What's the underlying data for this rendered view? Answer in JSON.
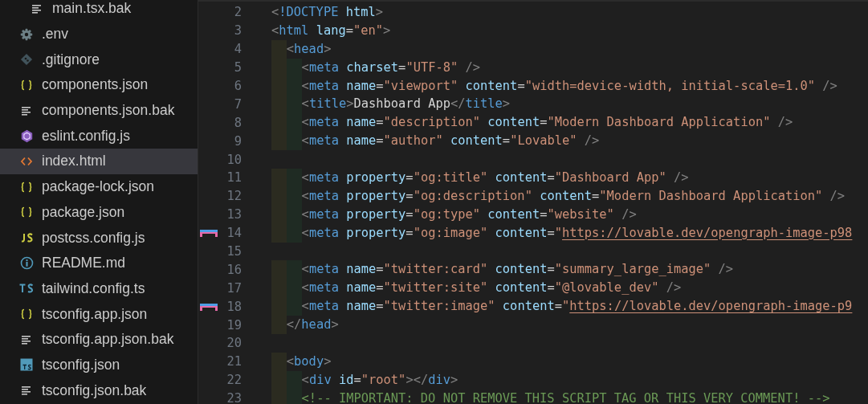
{
  "sidebar": {
    "items": [
      {
        "children": [
          {
            "name": "main.tsx.bak",
            "kind": "lines",
            "selected": false
          }
        ]
      },
      {
        "name": ".env",
        "kind": "gear",
        "selected": false
      },
      {
        "name": ".gitignore",
        "kind": "git",
        "selected": false
      },
      {
        "name": "components.json",
        "kind": "braces",
        "selected": false
      },
      {
        "name": "components.json.bak",
        "kind": "lines",
        "selected": false
      },
      {
        "name": "eslint.config.js",
        "kind": "eslint",
        "selected": false
      },
      {
        "name": "index.html",
        "kind": "html",
        "selected": true
      },
      {
        "name": "package-lock.json",
        "kind": "braces",
        "selected": false
      },
      {
        "name": "package.json",
        "kind": "braces",
        "selected": false
      },
      {
        "name": "postcss.config.js",
        "kind": "js",
        "selected": false
      },
      {
        "name": "README.md",
        "kind": "info",
        "selected": false
      },
      {
        "name": "tailwind.config.ts",
        "kind": "ts",
        "selected": false
      },
      {
        "name": "tsconfig.app.json",
        "kind": "braces",
        "selected": false
      },
      {
        "name": "tsconfig.app.json.bak",
        "kind": "lines",
        "selected": false
      },
      {
        "name": "tsconfig.json",
        "kind": "tsbox",
        "selected": false
      },
      {
        "name": "tsconfig.json.bak",
        "kind": "lines",
        "selected": false
      }
    ]
  },
  "editor": {
    "lines": [
      {
        "number": "2",
        "tokens": [
          {
            "kind": "punct",
            "text": "<"
          },
          {
            "kind": "tag",
            "text": "!DOCTYPE"
          },
          {
            "kind": "attr",
            "text": " html"
          },
          {
            "kind": "punct",
            "text": ">"
          }
        ]
      },
      {
        "number": "3",
        "tokens": [
          {
            "kind": "punct",
            "text": "<"
          },
          {
            "kind": "tag",
            "text": "html"
          },
          {
            "kind": "attr",
            "text": " lang"
          },
          {
            "kind": "text",
            "text": "="
          },
          {
            "kind": "string",
            "text": "\"en\""
          },
          {
            "kind": "punct",
            "text": ">"
          }
        ]
      },
      {
        "number": "4",
        "guides": [
          {
            "kind": "outer"
          }
        ],
        "tokens": [
          {
            "kind": "punct",
            "text": "<"
          },
          {
            "kind": "tag",
            "text": "head"
          },
          {
            "kind": "punct",
            "text": ">"
          }
        ]
      },
      {
        "number": "5",
        "guides": [
          {
            "kind": "outer"
          },
          {
            "kind": "inner"
          }
        ],
        "tokens": [
          {
            "kind": "punct",
            "text": "<"
          },
          {
            "kind": "tag",
            "text": "meta"
          },
          {
            "kind": "attr",
            "text": " charset"
          },
          {
            "kind": "text",
            "text": "="
          },
          {
            "kind": "string",
            "text": "\"UTF-8\""
          },
          {
            "kind": "punct",
            "text": " />"
          }
        ]
      },
      {
        "number": "6",
        "guides": [
          {
            "kind": "outer"
          },
          {
            "kind": "inner"
          }
        ],
        "tokens": [
          {
            "kind": "punct",
            "text": "<"
          },
          {
            "kind": "tag",
            "text": "meta"
          },
          {
            "kind": "attr",
            "text": " name"
          },
          {
            "kind": "text",
            "text": "="
          },
          {
            "kind": "string",
            "text": "\"viewport\""
          },
          {
            "kind": "attr",
            "text": " content"
          },
          {
            "kind": "text",
            "text": "="
          },
          {
            "kind": "string",
            "text": "\"width=device-width, initial-scale=1.0\""
          },
          {
            "kind": "punct",
            "text": " />"
          }
        ]
      },
      {
        "number": "7",
        "guides": [
          {
            "kind": "outer"
          },
          {
            "kind": "inner"
          }
        ],
        "tokens": [
          {
            "kind": "punct",
            "text": "<"
          },
          {
            "kind": "tag",
            "text": "title"
          },
          {
            "kind": "punct",
            "text": ">"
          },
          {
            "kind": "text",
            "text": "Dashboard App"
          },
          {
            "kind": "punct",
            "text": "</"
          },
          {
            "kind": "tag",
            "text": "title"
          },
          {
            "kind": "punct",
            "text": ">"
          }
        ]
      },
      {
        "number": "8",
        "guides": [
          {
            "kind": "outer"
          },
          {
            "kind": "inner"
          }
        ],
        "tokens": [
          {
            "kind": "punct",
            "text": "<"
          },
          {
            "kind": "tag",
            "text": "meta"
          },
          {
            "kind": "attr",
            "text": " name"
          },
          {
            "kind": "text",
            "text": "="
          },
          {
            "kind": "string",
            "text": "\"description\""
          },
          {
            "kind": "attr",
            "text": " content"
          },
          {
            "kind": "text",
            "text": "="
          },
          {
            "kind": "string",
            "text": "\"Modern Dashboard Application\""
          },
          {
            "kind": "punct",
            "text": " />"
          }
        ]
      },
      {
        "number": "9",
        "guides": [
          {
            "kind": "outer"
          },
          {
            "kind": "inner"
          }
        ],
        "tokens": [
          {
            "kind": "punct",
            "text": "<"
          },
          {
            "kind": "tag",
            "text": "meta"
          },
          {
            "kind": "attr",
            "text": " name"
          },
          {
            "kind": "text",
            "text": "="
          },
          {
            "kind": "string",
            "text": "\"author\""
          },
          {
            "kind": "attr",
            "text": " content"
          },
          {
            "kind": "text",
            "text": "="
          },
          {
            "kind": "string",
            "text": "\"Lovable\""
          },
          {
            "kind": "punct",
            "text": " />"
          }
        ]
      },
      {
        "number": "10"
      },
      {
        "number": "11",
        "guides": [
          {
            "kind": "outer"
          },
          {
            "kind": "inner"
          }
        ],
        "tokens": [
          {
            "kind": "punct",
            "text": "<"
          },
          {
            "kind": "tag",
            "text": "meta"
          },
          {
            "kind": "attr",
            "text": " property"
          },
          {
            "kind": "text",
            "text": "="
          },
          {
            "kind": "string",
            "text": "\"og:title\""
          },
          {
            "kind": "attr",
            "text": " content"
          },
          {
            "kind": "text",
            "text": "="
          },
          {
            "kind": "string",
            "text": "\"Dashboard App\""
          },
          {
            "kind": "punct",
            "text": " />"
          }
        ]
      },
      {
        "number": "12",
        "guides": [
          {
            "kind": "outer"
          },
          {
            "kind": "inner"
          }
        ],
        "tokens": [
          {
            "kind": "punct",
            "text": "<"
          },
          {
            "kind": "tag",
            "text": "meta"
          },
          {
            "kind": "attr",
            "text": " property"
          },
          {
            "kind": "text",
            "text": "="
          },
          {
            "kind": "string",
            "text": "\"og:description\""
          },
          {
            "kind": "attr",
            "text": " content"
          },
          {
            "kind": "text",
            "text": "="
          },
          {
            "kind": "string",
            "text": "\"Modern Dashboard Application\""
          },
          {
            "kind": "punct",
            "text": " />"
          }
        ]
      },
      {
        "number": "13",
        "guides": [
          {
            "kind": "outer"
          },
          {
            "kind": "inner"
          }
        ],
        "tokens": [
          {
            "kind": "punct",
            "text": "<"
          },
          {
            "kind": "tag",
            "text": "meta"
          },
          {
            "kind": "attr",
            "text": " property"
          },
          {
            "kind": "text",
            "text": "="
          },
          {
            "kind": "string",
            "text": "\"og:type\""
          },
          {
            "kind": "attr",
            "text": " content"
          },
          {
            "kind": "text",
            "text": "="
          },
          {
            "kind": "string",
            "text": "\"website\""
          },
          {
            "kind": "punct",
            "text": " />"
          }
        ]
      },
      {
        "number": "14",
        "marker": true,
        "guides": [
          {
            "kind": "outer"
          },
          {
            "kind": "inner"
          }
        ],
        "tokens": [
          {
            "kind": "punct",
            "text": "<"
          },
          {
            "kind": "tag",
            "text": "meta"
          },
          {
            "kind": "attr",
            "text": " property"
          },
          {
            "kind": "text",
            "text": "="
          },
          {
            "kind": "string",
            "text": "\"og:image\""
          },
          {
            "kind": "attr",
            "text": " content"
          },
          {
            "kind": "text",
            "text": "="
          },
          {
            "kind": "string",
            "text": "\""
          },
          {
            "kind": "link",
            "text": "https://lovable.dev/opengraph-image-p98"
          }
        ]
      },
      {
        "number": "15"
      },
      {
        "number": "16",
        "guides": [
          {
            "kind": "outer"
          },
          {
            "kind": "inner"
          }
        ],
        "tokens": [
          {
            "kind": "punct",
            "text": "<"
          },
          {
            "kind": "tag",
            "text": "meta"
          },
          {
            "kind": "attr",
            "text": " name"
          },
          {
            "kind": "text",
            "text": "="
          },
          {
            "kind": "string",
            "text": "\"twitter:card\""
          },
          {
            "kind": "attr",
            "text": " content"
          },
          {
            "kind": "text",
            "text": "="
          },
          {
            "kind": "string",
            "text": "\"summary_large_image\""
          },
          {
            "kind": "punct",
            "text": " />"
          }
        ]
      },
      {
        "number": "17",
        "guides": [
          {
            "kind": "outer"
          },
          {
            "kind": "inner"
          }
        ],
        "tokens": [
          {
            "kind": "punct",
            "text": "<"
          },
          {
            "kind": "tag",
            "text": "meta"
          },
          {
            "kind": "attr",
            "text": " name"
          },
          {
            "kind": "text",
            "text": "="
          },
          {
            "kind": "string",
            "text": "\"twitter:site\""
          },
          {
            "kind": "attr",
            "text": " content"
          },
          {
            "kind": "text",
            "text": "="
          },
          {
            "kind": "string",
            "text": "\"@lovable_dev\""
          },
          {
            "kind": "punct",
            "text": " />"
          }
        ]
      },
      {
        "number": "18",
        "marker": true,
        "guides": [
          {
            "kind": "outer"
          },
          {
            "kind": "inner"
          }
        ],
        "tokens": [
          {
            "kind": "punct",
            "text": "<"
          },
          {
            "kind": "tag",
            "text": "meta"
          },
          {
            "kind": "attr",
            "text": " name"
          },
          {
            "kind": "text",
            "text": "="
          },
          {
            "kind": "string",
            "text": "\"twitter:image\""
          },
          {
            "kind": "attr",
            "text": " content"
          },
          {
            "kind": "text",
            "text": "="
          },
          {
            "kind": "string",
            "text": "\""
          },
          {
            "kind": "link",
            "text": "https://lovable.dev/opengraph-image-p9"
          }
        ]
      },
      {
        "number": "19",
        "guides": [
          {
            "kind": "outer"
          }
        ],
        "tokens": [
          {
            "kind": "punct",
            "text": "</"
          },
          {
            "kind": "tag",
            "text": "head"
          },
          {
            "kind": "punct",
            "text": ">"
          }
        ]
      },
      {
        "number": "20"
      },
      {
        "number": "21",
        "guides": [
          {
            "kind": "outer"
          }
        ],
        "tokens": [
          {
            "kind": "punct",
            "text": "<"
          },
          {
            "kind": "tag",
            "text": "body"
          },
          {
            "kind": "punct",
            "text": ">"
          }
        ]
      },
      {
        "number": "22",
        "guides": [
          {
            "kind": "outer"
          },
          {
            "kind": "inner"
          }
        ],
        "tokens": [
          {
            "kind": "punct",
            "text": "<"
          },
          {
            "kind": "tag",
            "text": "div"
          },
          {
            "kind": "attr",
            "text": " id"
          },
          {
            "kind": "text",
            "text": "="
          },
          {
            "kind": "string",
            "text": "\"root\""
          },
          {
            "kind": "punct",
            "text": "></"
          },
          {
            "kind": "tag",
            "text": "div"
          },
          {
            "kind": "punct",
            "text": ">"
          }
        ]
      },
      {
        "number": "23",
        "guides": [
          {
            "kind": "outer"
          },
          {
            "kind": "inner"
          }
        ],
        "tokens": [
          {
            "kind": "comment",
            "text": "<!-- IMPORTANT: DO NOT REMOVE THIS SCRIPT TAG OR THIS VERY COMMENT! -->"
          }
        ]
      }
    ]
  }
}
